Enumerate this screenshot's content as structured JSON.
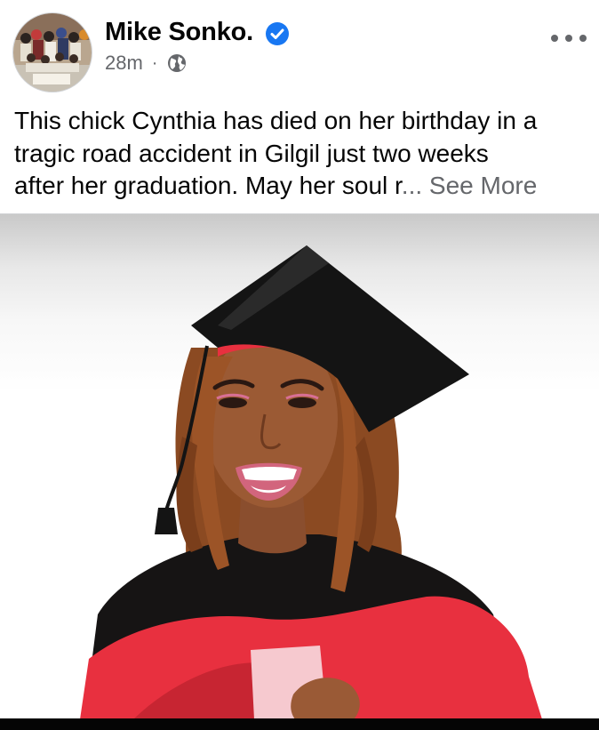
{
  "post": {
    "author": "Mike Sonko.",
    "verified": true,
    "timestamp": "28m",
    "separator": "·",
    "audience_icon": "globe-icon",
    "more_icon": "more-options-icon",
    "text_lines": [
      "This chick Cynthia has died on her birthday in a",
      "tragic road accident in Gilgil just two weeks",
      "after her graduation. May her soul r"
    ],
    "ellipsis": "...",
    "see_more": "See More"
  },
  "colors": {
    "verified_blue": "#1877f2",
    "secondary_text": "#65676b",
    "gown_red": "#e8303f",
    "cap_black": "#141414"
  },
  "photo": {
    "subject": "graduation-portrait"
  }
}
